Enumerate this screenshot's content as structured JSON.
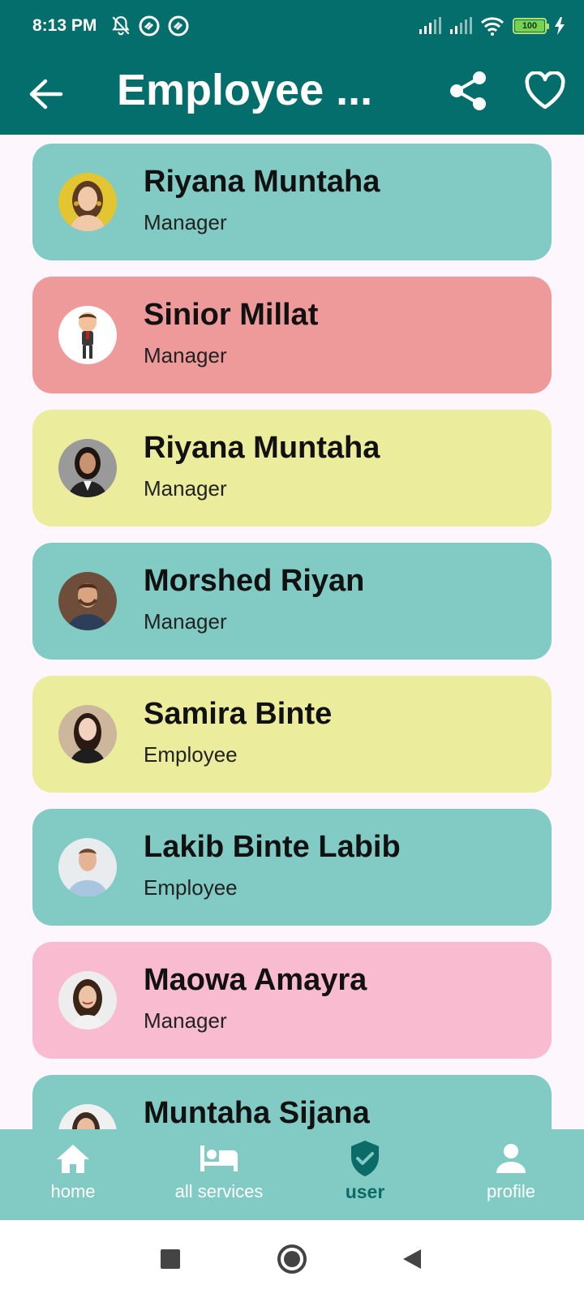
{
  "status_bar": {
    "time": "8:13 PM",
    "battery": "100"
  },
  "app_bar": {
    "title": "Employee ..."
  },
  "employees": [
    {
      "name": "Riyana Muntaha",
      "role": "Manager",
      "color": "#81cbc4",
      "avatar": "woman-yellow-avatar"
    },
    {
      "name": "Sinior Millat",
      "role": "Manager",
      "color": "#ef9a9a",
      "avatar": "cartoon-man-avatar"
    },
    {
      "name": "Riyana Muntaha",
      "role": "Manager",
      "color": "#ebed9d",
      "avatar": "woman-suit-avatar"
    },
    {
      "name": "Morshed Riyan",
      "role": "Manager",
      "color": "#81cbc4",
      "avatar": "man-beard-avatar"
    },
    {
      "name": "Samira Binte",
      "role": "Employee",
      "color": "#ebed9d",
      "avatar": "woman-dark-hair-avatar"
    },
    {
      "name": "Lakib Binte Labib",
      "role": "Employee",
      "color": "#81cbc4",
      "avatar": "man-shirt-avatar"
    },
    {
      "name": "Maowa Amayra",
      "role": "Manager",
      "color": "#f8bbd0",
      "avatar": "woman-smile-avatar"
    },
    {
      "name": "Muntaha Sijana",
      "role": "",
      "color": "#81cbc4",
      "avatar": "woman-partial-avatar"
    }
  ],
  "bottom_nav": [
    {
      "label": "home",
      "icon": "home-icon",
      "active": false
    },
    {
      "label": "all services",
      "icon": "bed-icon",
      "active": false
    },
    {
      "label": "user",
      "icon": "shield-check-icon",
      "active": true
    },
    {
      "label": "profile",
      "icon": "person-icon",
      "active": false
    }
  ],
  "colors": {
    "primary": "#036e6b",
    "nav_bg": "#81cbc4",
    "background": "#fdf6fd"
  }
}
